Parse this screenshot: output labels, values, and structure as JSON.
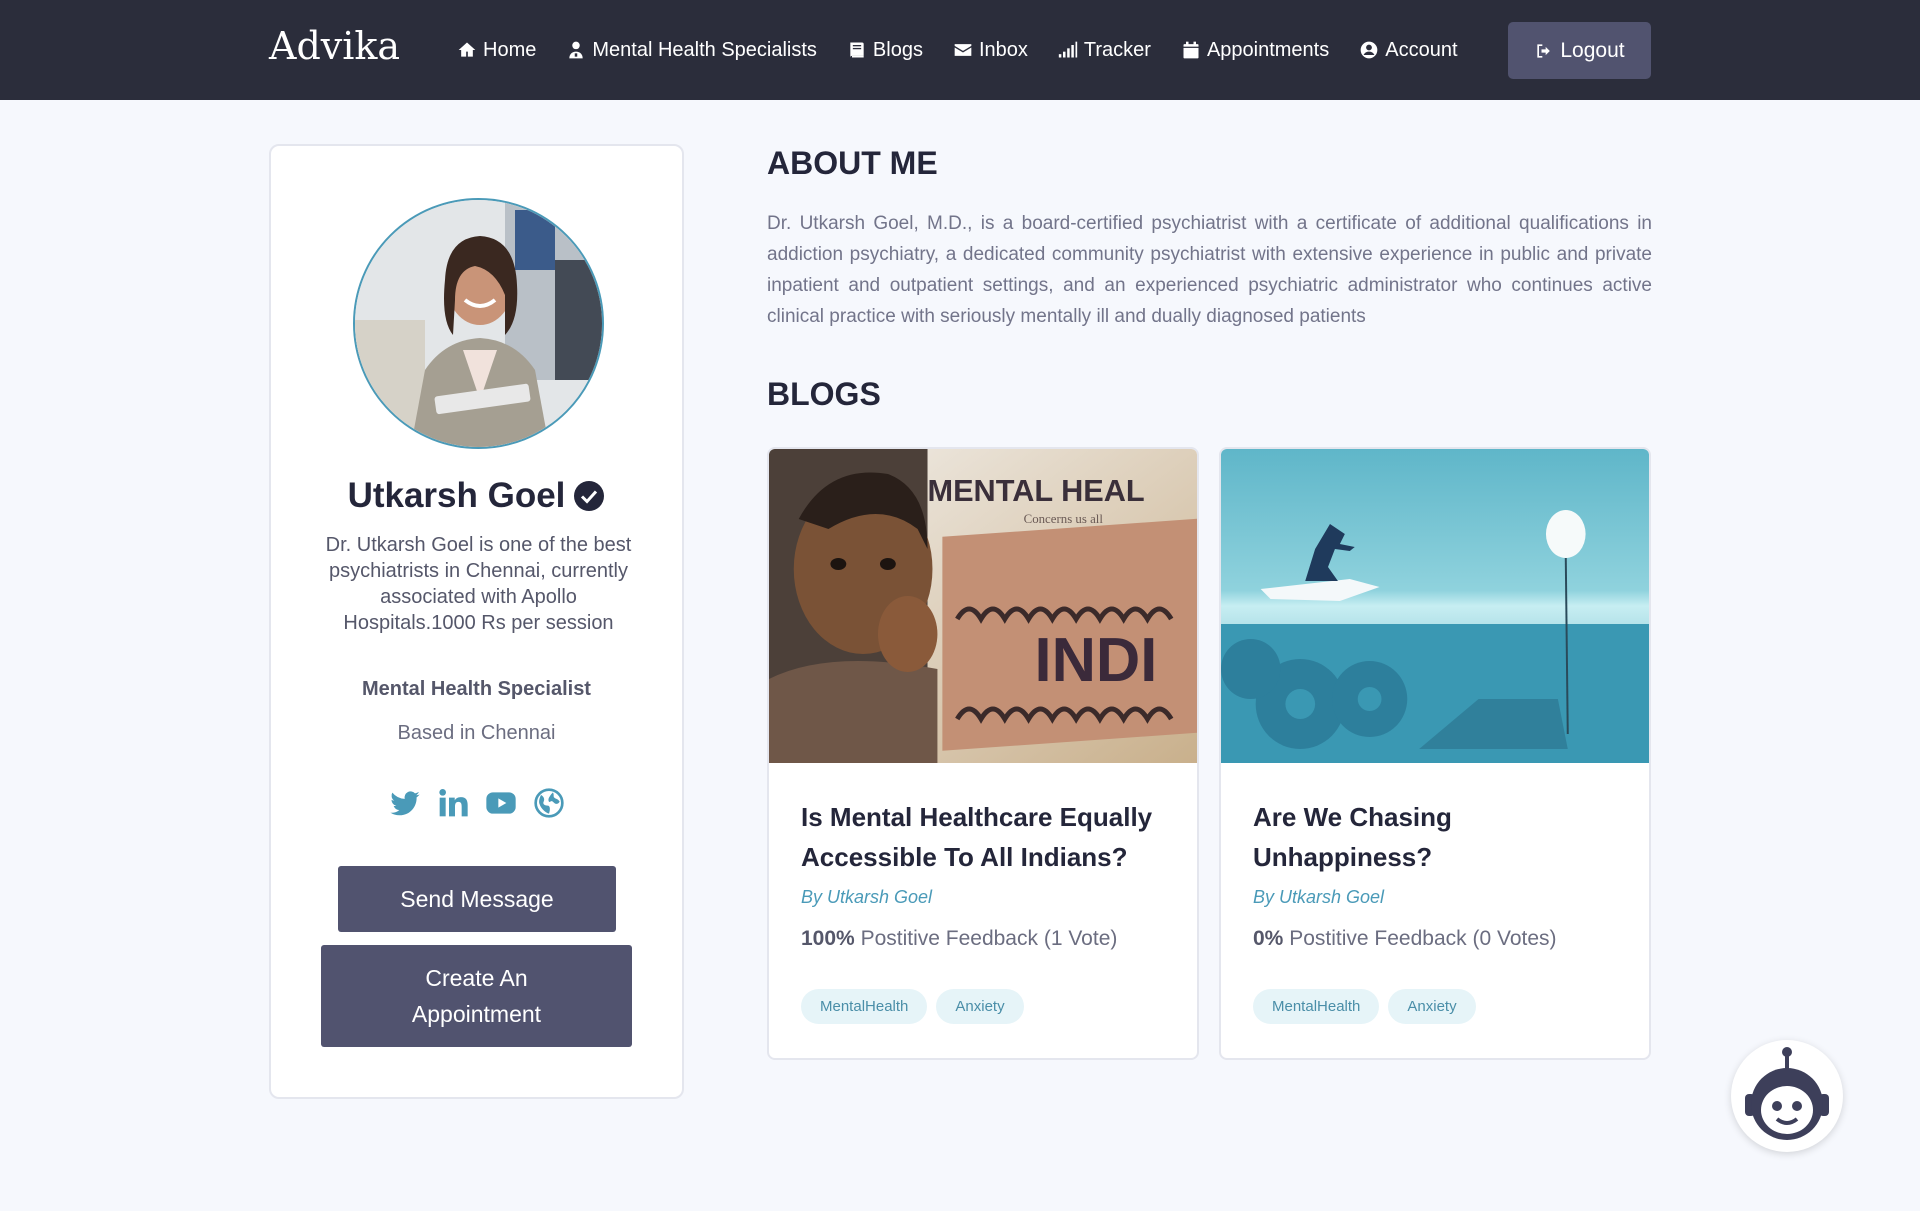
{
  "nav": {
    "brand": "Advika",
    "items": [
      {
        "label": "Home",
        "icon": "home-icon"
      },
      {
        "label": "Mental Health Specialists",
        "icon": "user-md-icon"
      },
      {
        "label": "Blogs",
        "icon": "book-icon"
      },
      {
        "label": "Inbox",
        "icon": "envelope-icon"
      },
      {
        "label": "Tracker",
        "icon": "signal-icon"
      },
      {
        "label": "Appointments",
        "icon": "calendar-icon"
      },
      {
        "label": "Account",
        "icon": "user-circle-icon"
      }
    ],
    "logout_label": "Logout"
  },
  "profile": {
    "name": "Utkarsh Goel",
    "bio": "Dr. Utkarsh Goel is one of the best psychiatrists in Chennai, currently associated with Apollo Hospitals.1000 Rs per session",
    "role": "Mental Health Specialist",
    "location": "Based in Chennai",
    "socials": [
      "twitter-icon",
      "linkedin-icon",
      "youtube-icon",
      "globe-icon"
    ],
    "send_message_label": "Send Message",
    "appointment_label": "Create An Appointment"
  },
  "about": {
    "heading": "ABOUT ME",
    "text": "Dr. Utkarsh Goel, M.D., is a board-certified psychiatrist with a certificate of additional qualifications in addiction psychiatry, a dedicated community psychiatrist with extensive experience in public and private inpatient and outpatient settings, and an experienced psychiatric administrator who continues active clinical practice with seriously mentally ill and dually diagnosed patients"
  },
  "blogs": {
    "heading": "BLOGS",
    "items": [
      {
        "title": "Is Mental Healthcare Equally Accessible To All Indians?",
        "author": "By Utkarsh Goel",
        "feedback_pct": "100%",
        "feedback_text": "Postitive Feedback (1 Vote)",
        "tags": [
          "MentalHealth",
          "Anxiety"
        ],
        "image_text": {
          "line1": "MENTAL HEAL",
          "line2": "Concerns us all",
          "line3": "INDI"
        }
      },
      {
        "title": "Are We Chasing Unhappiness?",
        "author": "By Utkarsh Goel",
        "feedback_pct": "0%",
        "feedback_text": "Postitive Feedback (0 Votes)",
        "tags": [
          "MentalHealth",
          "Anxiety"
        ]
      }
    ]
  },
  "colors": {
    "navbar": "#2b2d3b",
    "button": "#51536f",
    "accent": "#4a9ab8",
    "background": "#f6f8fd"
  }
}
